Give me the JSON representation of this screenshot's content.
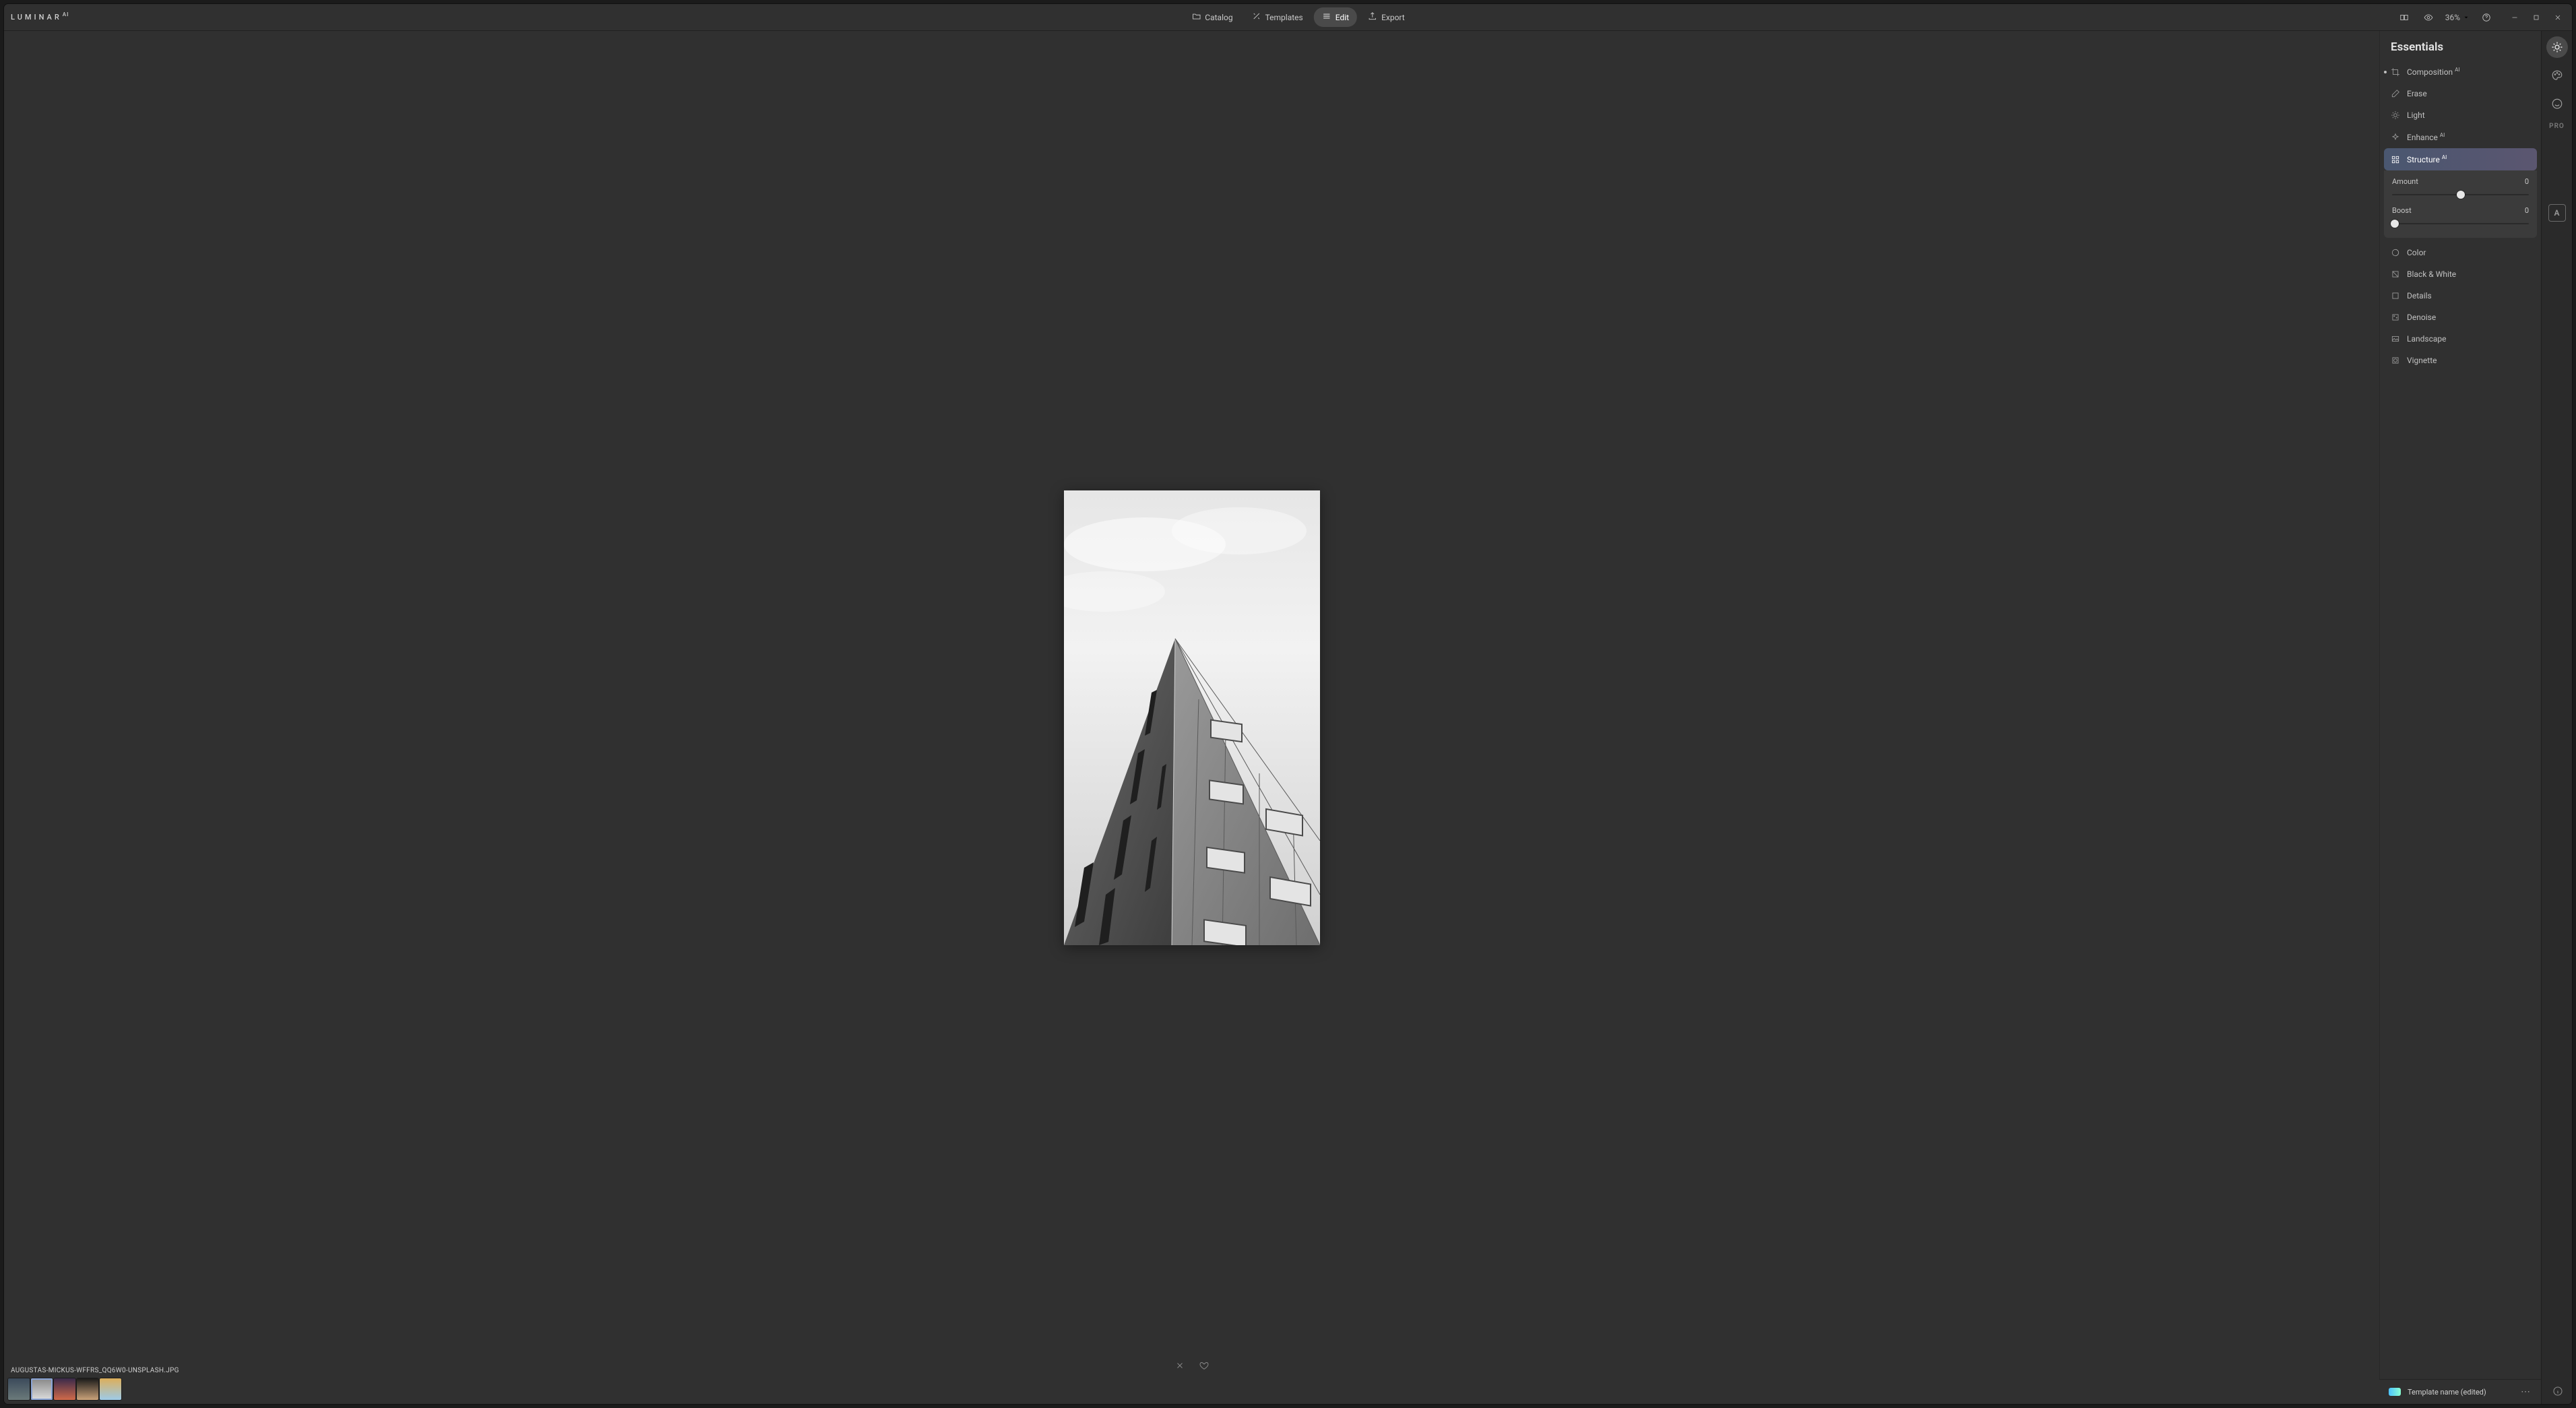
{
  "app": {
    "name": "LUMINAR",
    "suffix": "AI"
  },
  "nav": {
    "catalog": "Catalog",
    "templates": "Templates",
    "edit": "Edit",
    "export": "Export"
  },
  "top_right": {
    "zoom": "36%"
  },
  "panel": {
    "title": "Essentials",
    "tools": {
      "composition": "Composition",
      "erase": "Erase",
      "light": "Light",
      "enhance": "Enhance",
      "structure": "Structure",
      "color": "Color",
      "bw": "Black & White",
      "details": "Details",
      "denoise": "Denoise",
      "landscape": "Landscape",
      "vignette": "Vignette"
    },
    "ai_suffix": "AI",
    "structure_panel": {
      "amount_label": "Amount",
      "amount_value": "0",
      "amount_pos_pct": 50,
      "boost_label": "Boost",
      "boost_value": "0",
      "boost_pos_pct": 2
    }
  },
  "rail": {
    "pro": "PRO",
    "mask_letter": "A"
  },
  "filename": "AUGUSTAS-MICKUS-WFFRS_QQ6W0-UNSPLASH.JPG",
  "status": {
    "template": "Template name (edited)"
  },
  "thumbs": [
    {
      "g": [
        "#3b4a5a",
        "#6b7a7a"
      ]
    },
    {
      "g": [
        "#888",
        "#ddd"
      ]
    },
    {
      "g": [
        "#3a2a4a",
        "#d06a4a"
      ]
    },
    {
      "g": [
        "#1a1a1a",
        "#caa27a"
      ]
    },
    {
      "g": [
        "#dcae5a",
        "#9ecbe8"
      ]
    }
  ]
}
